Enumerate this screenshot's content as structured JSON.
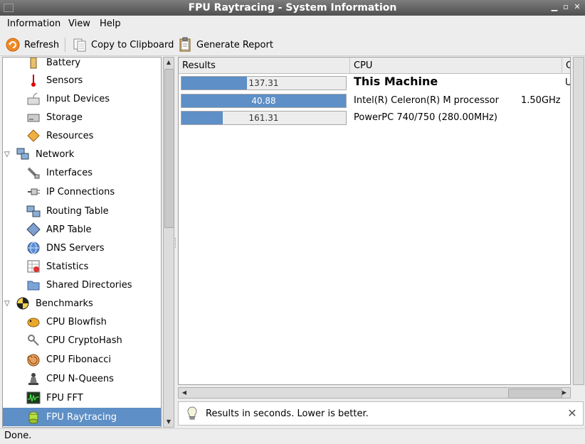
{
  "window": {
    "title": "FPU Raytracing - System Information"
  },
  "menu": {
    "items": [
      "Information",
      "View",
      "Help"
    ]
  },
  "toolbar": {
    "refresh": "Refresh",
    "copy": "Copy to Clipboard",
    "report": "Generate Report"
  },
  "tree": {
    "items": [
      {
        "label": "Battery",
        "icon": "battery-icon"
      },
      {
        "label": "Sensors",
        "icon": "thermometer-icon"
      },
      {
        "label": "Input Devices",
        "icon": "keyboard-icon"
      },
      {
        "label": "Storage",
        "icon": "harddisk-icon"
      },
      {
        "label": "Resources",
        "icon": "resources-icon"
      },
      {
        "label": "Network",
        "icon": "network-icon",
        "expander": "▽"
      },
      {
        "label": "Interfaces",
        "icon": "network-cable-icon"
      },
      {
        "label": "IP Connections",
        "icon": "plug-icon"
      },
      {
        "label": "Routing Table",
        "icon": "routing-icon"
      },
      {
        "label": "ARP Table",
        "icon": "arp-icon"
      },
      {
        "label": "DNS Servers",
        "icon": "globe-icon"
      },
      {
        "label": "Statistics",
        "icon": "statistics-icon"
      },
      {
        "label": "Shared Directories",
        "icon": "folder-icon"
      },
      {
        "label": "Benchmarks",
        "icon": "benchmark-icon",
        "expander": "▽"
      },
      {
        "label": "CPU Blowfish",
        "icon": "blowfish-icon"
      },
      {
        "label": "CPU CryptoHash",
        "icon": "keys-icon"
      },
      {
        "label": "CPU Fibonacci",
        "icon": "shell-icon"
      },
      {
        "label": "CPU N-Queens",
        "icon": "chess-icon"
      },
      {
        "label": "FPU FFT",
        "icon": "fft-icon"
      },
      {
        "label": "FPU Raytracing",
        "icon": "raytracing-icon",
        "selected": true
      }
    ]
  },
  "results": {
    "columns": [
      "Results",
      "CPU",
      "C"
    ],
    "rows": [
      {
        "value": "137.31",
        "fill": 0.4,
        "cpu": "This Machine",
        "mhz": "U",
        "bold": true
      },
      {
        "value": "40.88",
        "fill": 1.0,
        "cpu": "Intel(R) Celeron(R) M processor",
        "mhz": "1.50GHz",
        "bold": false
      },
      {
        "value": "161.31",
        "fill": 0.25,
        "cpu": "PowerPC 740/750 (280.00MHz)",
        "mhz": "",
        "bold": false
      }
    ]
  },
  "info": {
    "message": "Results in seconds. Lower is better."
  },
  "status": {
    "text": "Done."
  },
  "colors": {
    "selection": "#5e8fc6",
    "bar": "#5e8fc6"
  }
}
